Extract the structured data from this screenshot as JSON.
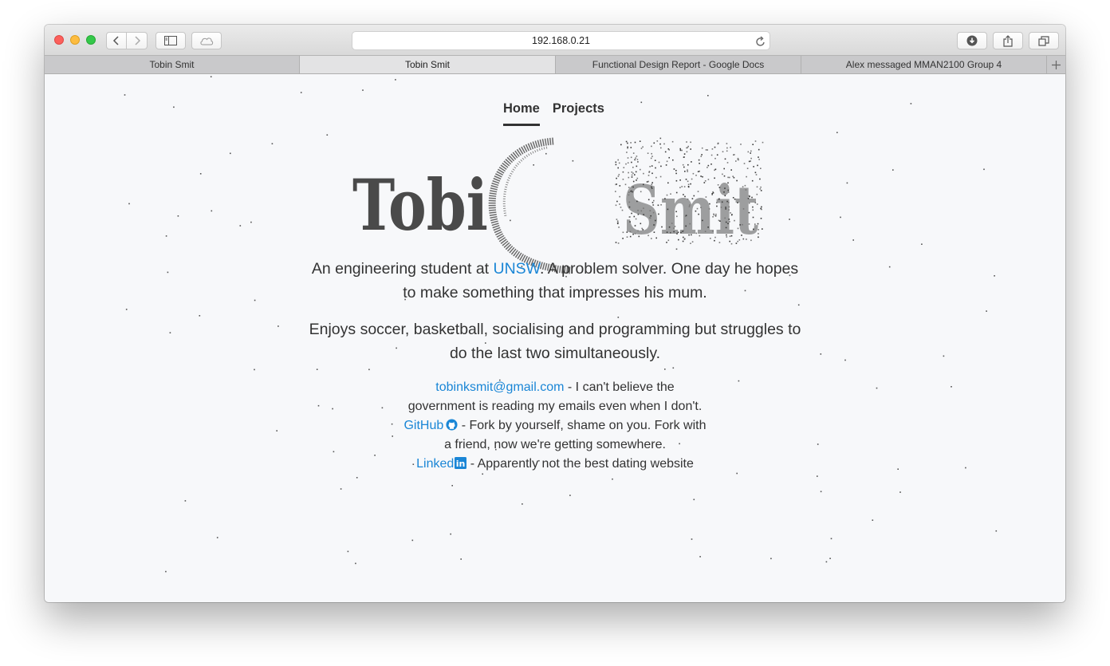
{
  "browser": {
    "address": "192.168.0.21",
    "tabs": [
      {
        "label": "Tobin Smit",
        "active": false
      },
      {
        "label": "Tobin Smit",
        "active": true
      },
      {
        "label": "Functional Design Report - Google Docs",
        "active": false
      },
      {
        "label": "Alex messaged MMAN2100 Group 4",
        "active": false
      }
    ],
    "new_tab_label": "+"
  },
  "nav": {
    "home": "Home",
    "projects": "Projects"
  },
  "logo": {
    "text": "Tobin Smit"
  },
  "bio": {
    "line1_pre": "An engineering student at ",
    "line1_link": "UNSW",
    "line1_post": ". A problem solver. One day he hopes",
    "line2": "to make something that impresses his mum.",
    "line3": "Enjoys soccer, basketball, socialising and programming but struggles to",
    "line4": "do the last two simultaneously."
  },
  "contact": {
    "email": "tobinksmit@gmail.com",
    "email_desc_1": " - I can't believe the",
    "email_desc_2": "government is reading my emails even when I don't.",
    "github": "GitHub",
    "github_desc_1": " - Fork by yourself, shame on you. Fork with",
    "github_desc_2": "a friend, now we're getting somewhere.",
    "linkedin": "Linked",
    "linkedin_badge": "in",
    "linkedin_desc": " - Apparently not the best dating website"
  },
  "colors": {
    "link": "#1a86d6",
    "text": "#333333",
    "page_bg": "#f7f8fa",
    "logo_fill": "#4a4a4a"
  },
  "icons": [
    "back-icon",
    "forward-icon",
    "sidebar-icon",
    "icloud-icon",
    "reload-icon",
    "download-icon",
    "share-icon",
    "tabs-overview-icon",
    "github-icon",
    "linkedin-icon"
  ]
}
